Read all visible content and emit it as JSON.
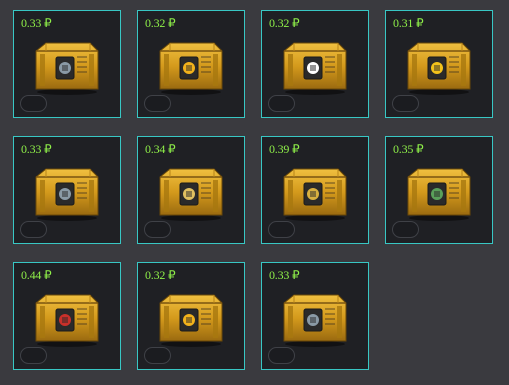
{
  "items": [
    {
      "price": "0.33 ₽",
      "emblem": "tower-emblem-icon",
      "accent": "#8a9aa6"
    },
    {
      "price": "0.32 ₽",
      "emblem": "hammer-emblem-icon",
      "accent": "#f2b21b"
    },
    {
      "price": "0.32 ₽",
      "emblem": "star-emblem-icon",
      "accent": "#ffffff"
    },
    {
      "price": "0.31 ₽",
      "emblem": "sun-emblem-icon",
      "accent": "#f2c21b"
    },
    {
      "price": "0.33 ₽",
      "emblem": "tower-emblem-icon",
      "accent": "#8a9aa6"
    },
    {
      "price": "0.34 ₽",
      "emblem": "shield-emblem-icon",
      "accent": "#e0c060"
    },
    {
      "price": "0.39 ₽",
      "emblem": "grid-emblem-icon",
      "accent": "#d8b040"
    },
    {
      "price": "0.35 ₽",
      "emblem": "castle-emblem-icon",
      "accent": "#5aa05a"
    },
    {
      "price": "0.44 ₽",
      "emblem": "skull-emblem-icon",
      "accent": "#c8302a"
    },
    {
      "price": "0.32 ₽",
      "emblem": "hammer-emblem-icon",
      "accent": "#f2b21b"
    },
    {
      "price": "0.33 ₽",
      "emblem": "tower-emblem-icon",
      "accent": "#8a9aa6"
    }
  ]
}
